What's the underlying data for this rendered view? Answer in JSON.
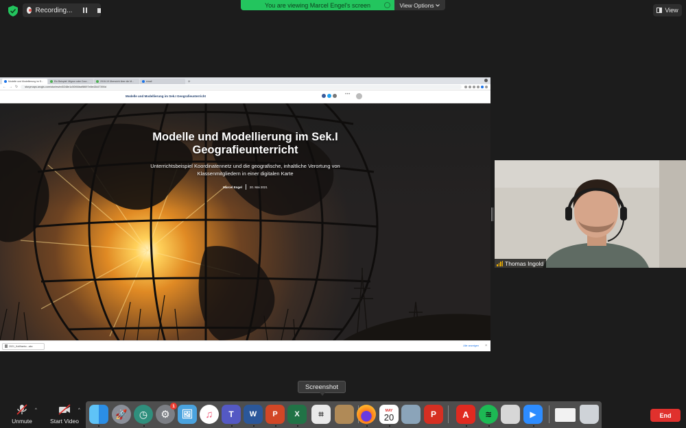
{
  "recording": {
    "label": "Recording..."
  },
  "banner": {
    "text": "You are viewing Marcel Engel's screen"
  },
  "view_options": {
    "label": "View Options"
  },
  "view_button": {
    "label": "View"
  },
  "browser": {
    "tabs": [
      {
        "label": "Modelle und Modellierung im S..."
      },
      {
        "label": "Ein Beispiel: Migron oder Cour..."
      },
      {
        "label": "2018-19 Übersicht über die M..."
      },
      {
        "label": "email"
      }
    ],
    "new_tab": "+",
    "url": "storymaps.arcgis.com/stories/ed0248e1c50f46ba98697e8e43447390d",
    "site_title": "Modelle und Modellierung im Sek.I Geografieunterricht",
    "more": "•••",
    "download_item": "2021_Koll9aebc...abc",
    "download_show_all": "Alle anzeigen",
    "download_close": "×"
  },
  "story": {
    "title_line1": "Modelle und Modellierung im Sek.I",
    "title_line2": "Geografieunterricht",
    "subtitle_line1": "Unterrichtsbeispiel Koordinatennetz und die geografische, inhaltliche Verortung von",
    "subtitle_line2": "Klassenmitgliedern in einer digitalen Karte",
    "author": "Marcel Engel",
    "date": "20. Mai 2021"
  },
  "participant": {
    "name": "Thomas Ingold"
  },
  "tooltip": {
    "text": "Screenshot"
  },
  "controls": {
    "unmute": "Unmute",
    "start_video": "Start Video",
    "caret": "^",
    "end": "End"
  },
  "dock": {
    "mail_badge": "1",
    "calendar_month": "MAY",
    "calendar_day": "20",
    "word_letter": "W",
    "powerpoint_letter": "P",
    "excel_letter": "X"
  },
  "colors": {
    "banner_green": "#23c55e",
    "end_red": "#e0312d",
    "signal_yellow": "#f2b200"
  }
}
